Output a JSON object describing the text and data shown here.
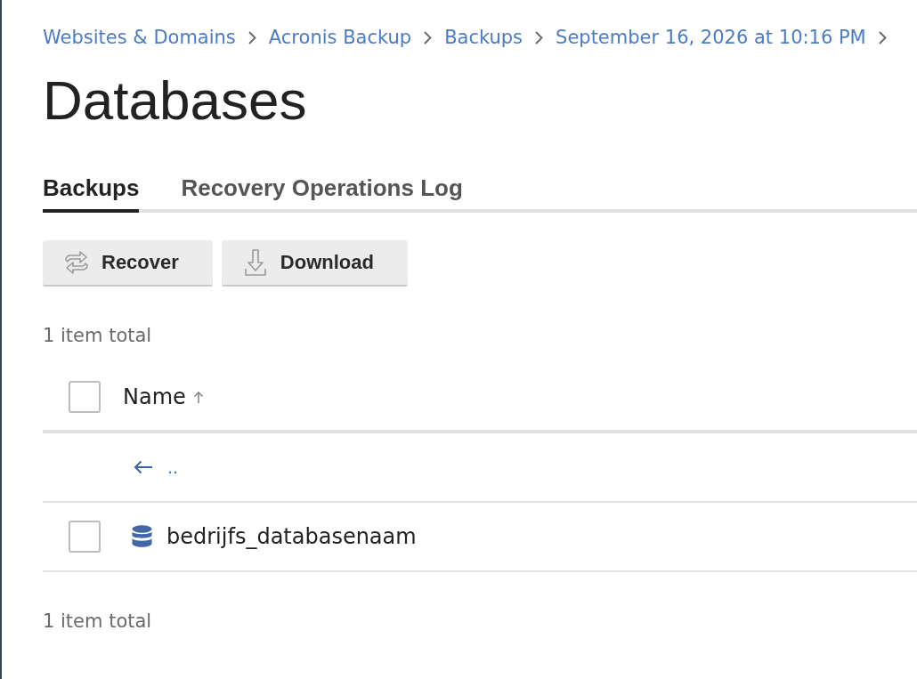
{
  "breadcrumbs": [
    {
      "label": "Websites & Domains"
    },
    {
      "label": "Acronis Backup"
    },
    {
      "label": "Backups"
    },
    {
      "label": "September 16, 2026 at 10:16 PM"
    }
  ],
  "title": "Databases",
  "tabs": [
    {
      "label": "Backups",
      "selected": true
    },
    {
      "label": "Recovery Operations Log",
      "selected": false
    }
  ],
  "toolbar": {
    "buttons": [
      {
        "label": "Recover",
        "kind": "recover"
      },
      {
        "label": "Download",
        "kind": "download"
      }
    ]
  },
  "summary_top": "1 item total",
  "table": {
    "header_checked": false,
    "columns": [
      {
        "label": "Name",
        "sort_ascending": true
      }
    ],
    "parent_link": {
      "label": ".."
    },
    "rows": [
      {
        "name": "bedrijfs_databasenaam",
        "checked": false
      }
    ]
  },
  "summary_bottom": "1 item total"
}
